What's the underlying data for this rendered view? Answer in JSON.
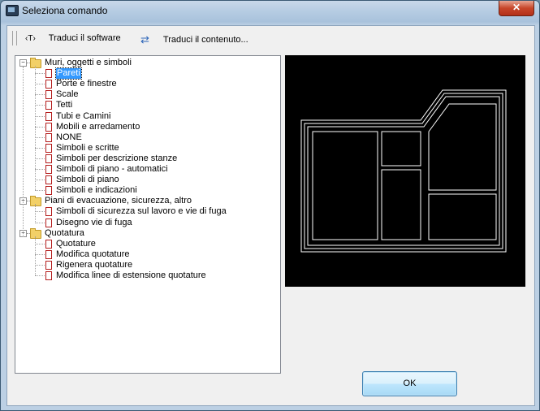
{
  "window": {
    "title": "Seleziona comando",
    "close_glyph": "✕"
  },
  "toolbar": {
    "translate_software_icon": "‹T›",
    "translate_software_label": "Traduci il software",
    "translate_content_icon": "⇄",
    "translate_content_label": "Traduci il contenuto..."
  },
  "tree": {
    "expanded_glyph": "−",
    "groups": [
      {
        "label": "Muri, oggetti e simboli",
        "items": [
          "Pareti",
          "Porte e finestre",
          "Scale",
          "Tetti",
          "Tubi e Camini",
          "Mobili e arredamento",
          "NONE",
          "Simboli e scritte",
          "Simboli per descrizione stanze",
          "Simboli di piano - automatici",
          "Simboli di piano",
          "Simboli e indicazioni"
        ]
      },
      {
        "label": "Piani di evacuazione, sicurezza, altro",
        "items": [
          "Simboli di sicurezza sul lavoro e vie di fuga",
          "Disegno vie di fuga"
        ]
      },
      {
        "label": "Quotatura",
        "items": [
          "Quotature",
          "Modifica quotature",
          "Rigenera quotature",
          "Modifica linee di estensione quotature"
        ]
      }
    ],
    "selected_item": "Pareti"
  },
  "buttons": {
    "ok": "OK"
  },
  "colors": {
    "selection": "#3399ff",
    "preview_background": "#000000",
    "preview_lines": "#ffffff"
  }
}
